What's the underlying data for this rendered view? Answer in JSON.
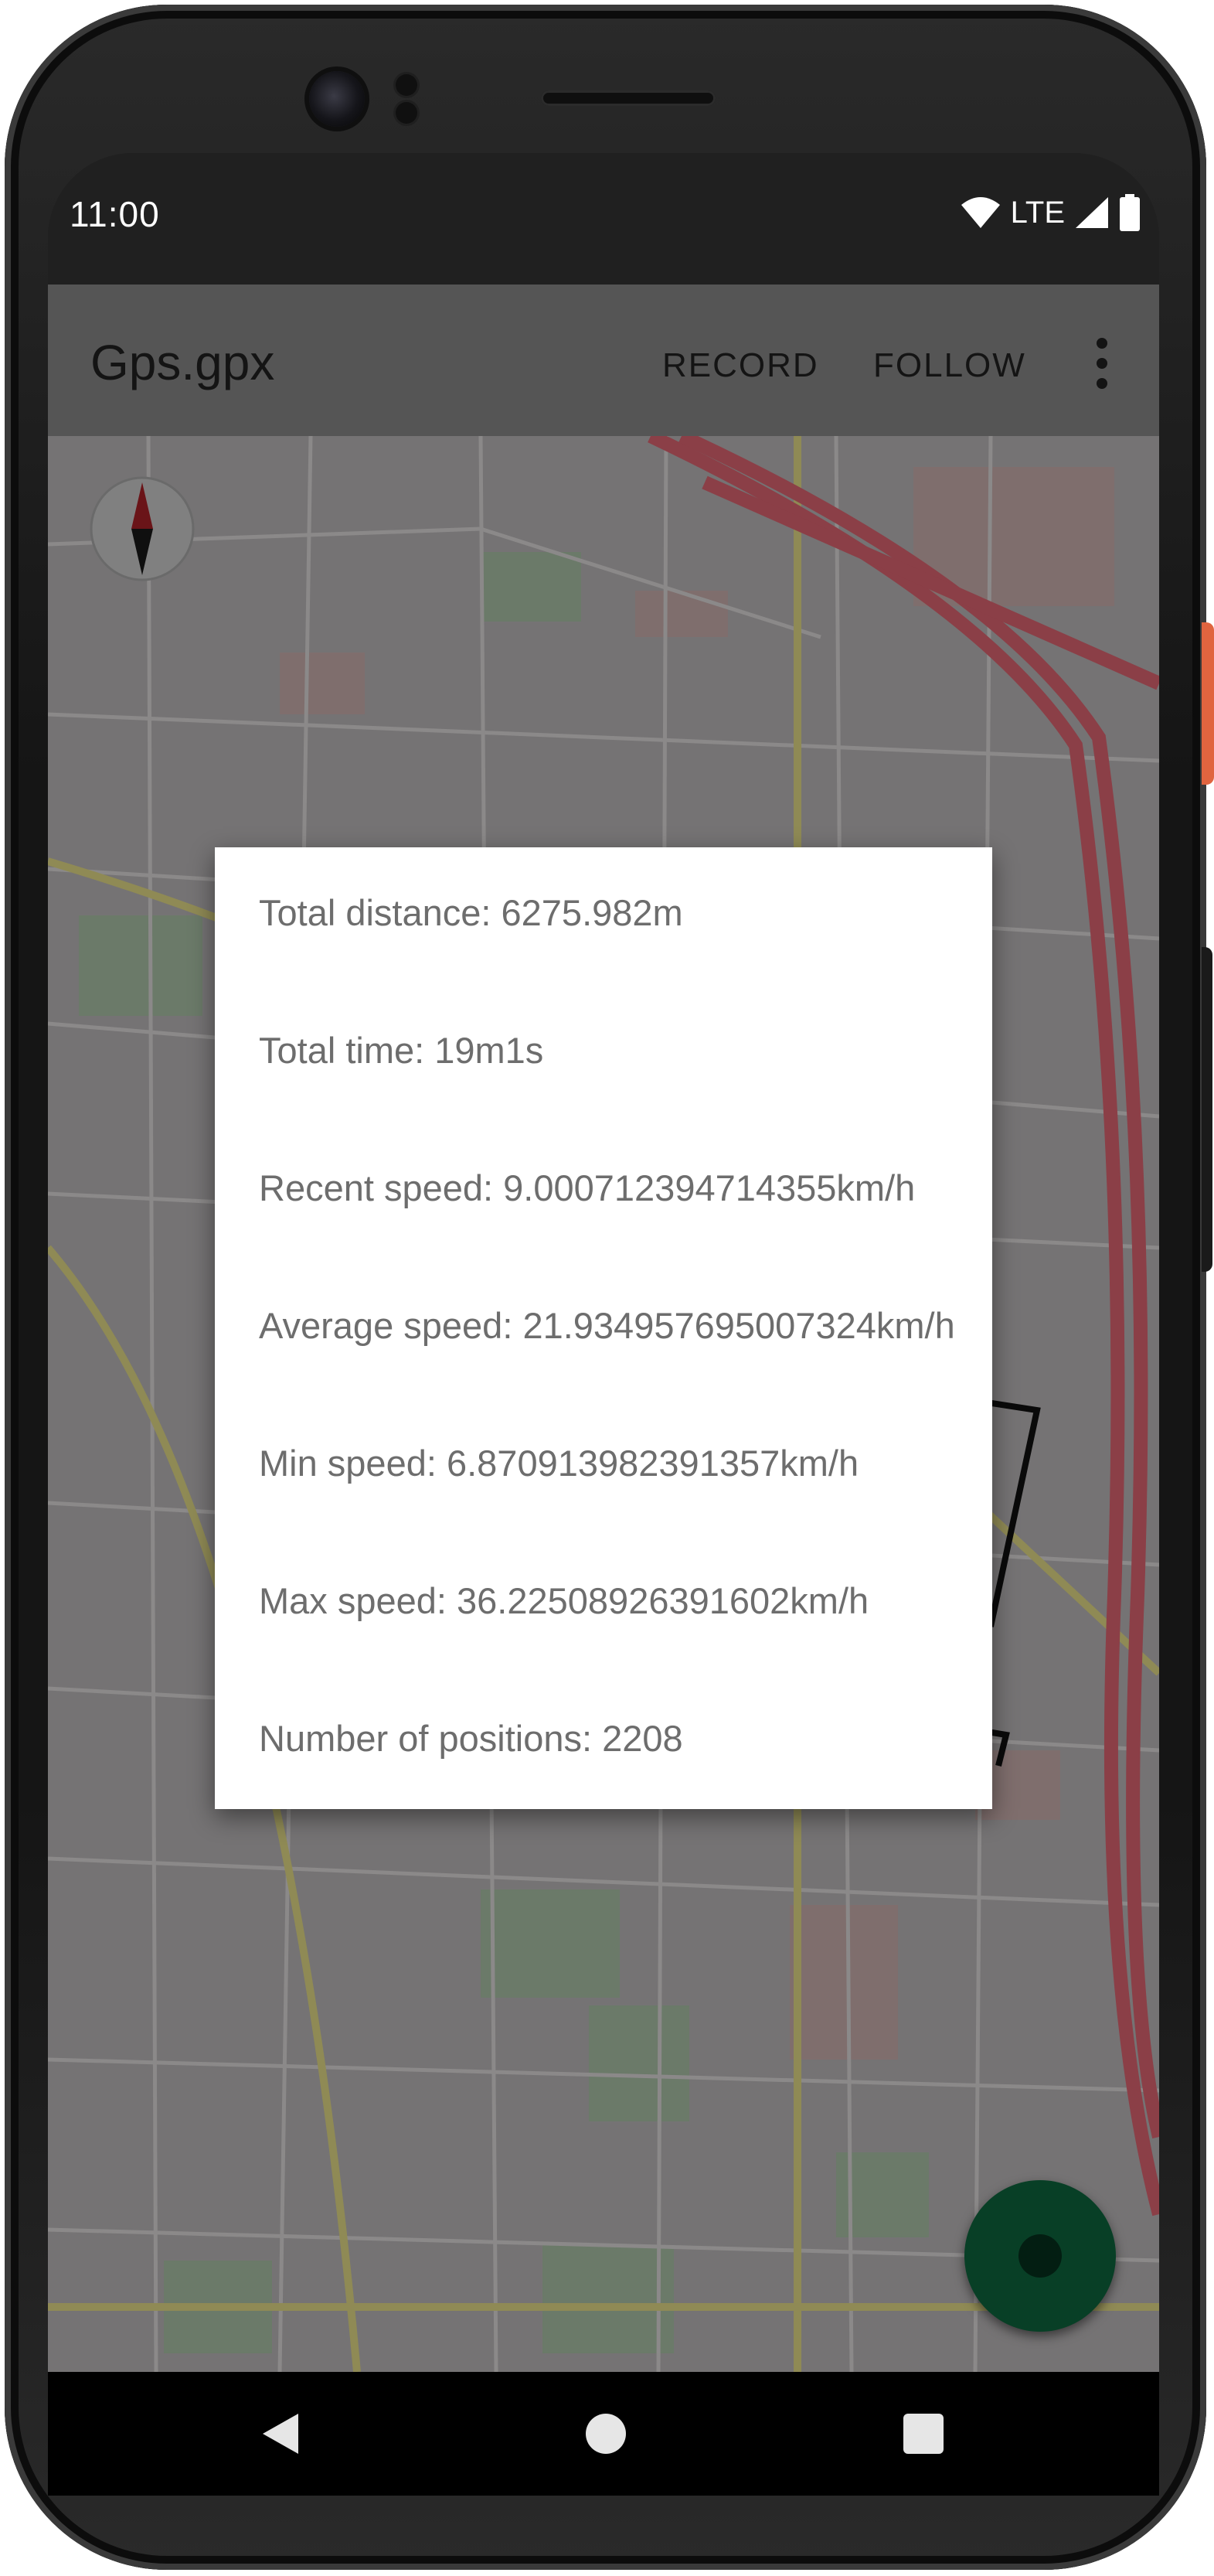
{
  "status_bar": {
    "time": "11:00",
    "network": "LTE",
    "icons": [
      "wifi-icon",
      "signal-icon",
      "battery-icon"
    ]
  },
  "app_bar": {
    "title": "Gps.gpx",
    "actions": [
      "RECORD",
      "FOLLOW"
    ],
    "overflow_icon": "more-vert-icon"
  },
  "map": {
    "compass_icon": "compass-icon"
  },
  "stats_dialog": {
    "items": [
      "Total distance: 6275.982m",
      "Total time: 19m1s",
      "Recent speed: 9.000712394714355km/h",
      "Average speed: 21.934957695007324km/h",
      "Min speed: 6.870913982391357km/h",
      "Max speed: 36.22508926391602km/h",
      "Number of positions: 2208"
    ]
  },
  "fab": {
    "icon": "record-icon"
  },
  "nav_bar": {
    "icons": [
      "back-icon",
      "home-icon",
      "recents-icon"
    ]
  },
  "colors": {
    "app_bar": "#555555",
    "map_dimmed": "#757374",
    "fab": "#083f26",
    "dialog_text": "#6d6d6d"
  }
}
